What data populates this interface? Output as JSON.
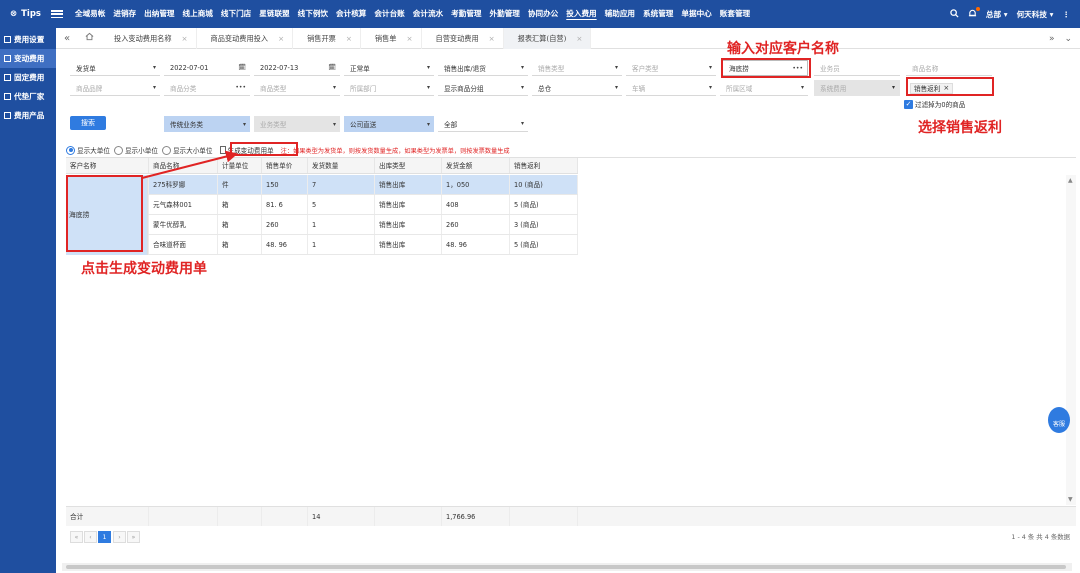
{
  "topnav": {
    "tips": "Tips",
    "menu": [
      "全域易帐",
      "进销存",
      "出纳管理",
      "线上商城",
      "线下门店",
      "星链联盟",
      "线下例饮",
      "会计核算",
      "会计台账",
      "会计流水",
      "考勤管理",
      "外勤管理",
      "协同办公",
      "投入费用",
      "辅助应用",
      "系统管理",
      "单据中心",
      "账套管理"
    ],
    "active_menu": "投入费用",
    "user": "总部 ▾",
    "company": "何天科技 ▾",
    "more": "⋮"
  },
  "sidebar": {
    "items": [
      "费用设置",
      "变动费用",
      "固定费用",
      "代垫厂家",
      "费用产品"
    ],
    "active": "变动费用"
  },
  "tabs": {
    "items": [
      {
        "label": "投入变动费用名称"
      },
      {
        "label": "商品变动费用投入"
      },
      {
        "label": "销售开票"
      },
      {
        "label": "销售单"
      },
      {
        "label": "自营变动费用"
      },
      {
        "label": "报表汇算(自营)"
      }
    ],
    "active_index": 5
  },
  "filters": {
    "doc_type": "发货单",
    "date_from": "2022-07-01",
    "date_to": "2022-07-13",
    "doc_status": "正常单",
    "out_type": "销售出库/退货",
    "sales_type_ph": "销售类型",
    "customer_type_ph": "客户类型",
    "customer": "海底捞",
    "salesman_ph": "业务员",
    "goods_name_ph": "商品名称",
    "brand_ph": "商品品牌",
    "goods_cat_ph": "商品分类",
    "goods_type_ph": "商品类型",
    "dept_ph": "所属部门",
    "show_group": "显示商品分组",
    "warehouse": "总仓",
    "vehicle_ph": "车辆",
    "region_ph": "所属区域",
    "sys_fee_ph": "系统费用",
    "selected_tag": "销售返利",
    "channel": "传统业务类",
    "biz_type_ph": "业务类型",
    "direct": "公司直送",
    "all": "全部",
    "filter_zero": "过滤掉为0的商品",
    "search": "搜索"
  },
  "radios": {
    "options": [
      "显示大单位",
      "显示小单位",
      "显示大小单位"
    ],
    "selected": 0,
    "generate": "生成变动费用单",
    "note": "注：如果类型为发货单，则按发货数量生成，如果类型为发票单，则按发票数量生成"
  },
  "table": {
    "headers": [
      "客户名称",
      "商品名称",
      "计量单位",
      "销售单价",
      "发货数量",
      "出库类型",
      "发货金额",
      "销售返利"
    ],
    "customer": "海底捞",
    "rows": [
      [
        "275科罗娜",
        "件",
        "150",
        "7",
        "销售出库",
        "1，050",
        "10 (商品)"
      ],
      [
        "元气森林001",
        "箱",
        "81. 6",
        "5",
        "销售出库",
        "408",
        "5 (商品)"
      ],
      [
        "蒙牛优醇乳",
        "箱",
        "260",
        "1",
        "销售出库",
        "260",
        "3 (商品)"
      ],
      [
        "合味道杯面",
        "箱",
        "48. 96",
        "1",
        "销售出库",
        "48. 96",
        "5 (商品)"
      ]
    ],
    "total_label": "合计",
    "total_qty": "14",
    "total_amount": "1,766.96"
  },
  "pager": {
    "current": "1",
    "info": "1 - 4 条  共 4 条数据"
  },
  "annotations": {
    "customer_hint": "输入对应客户名称",
    "rebate_hint": "选择销售返利",
    "generate_hint": "点击生成变动费用单"
  },
  "service": "客服",
  "colors": {
    "nav": "#1f4fa0",
    "accent": "#2f7be0",
    "annotation": "#e02424",
    "selected_row": "#cfe1f7"
  }
}
